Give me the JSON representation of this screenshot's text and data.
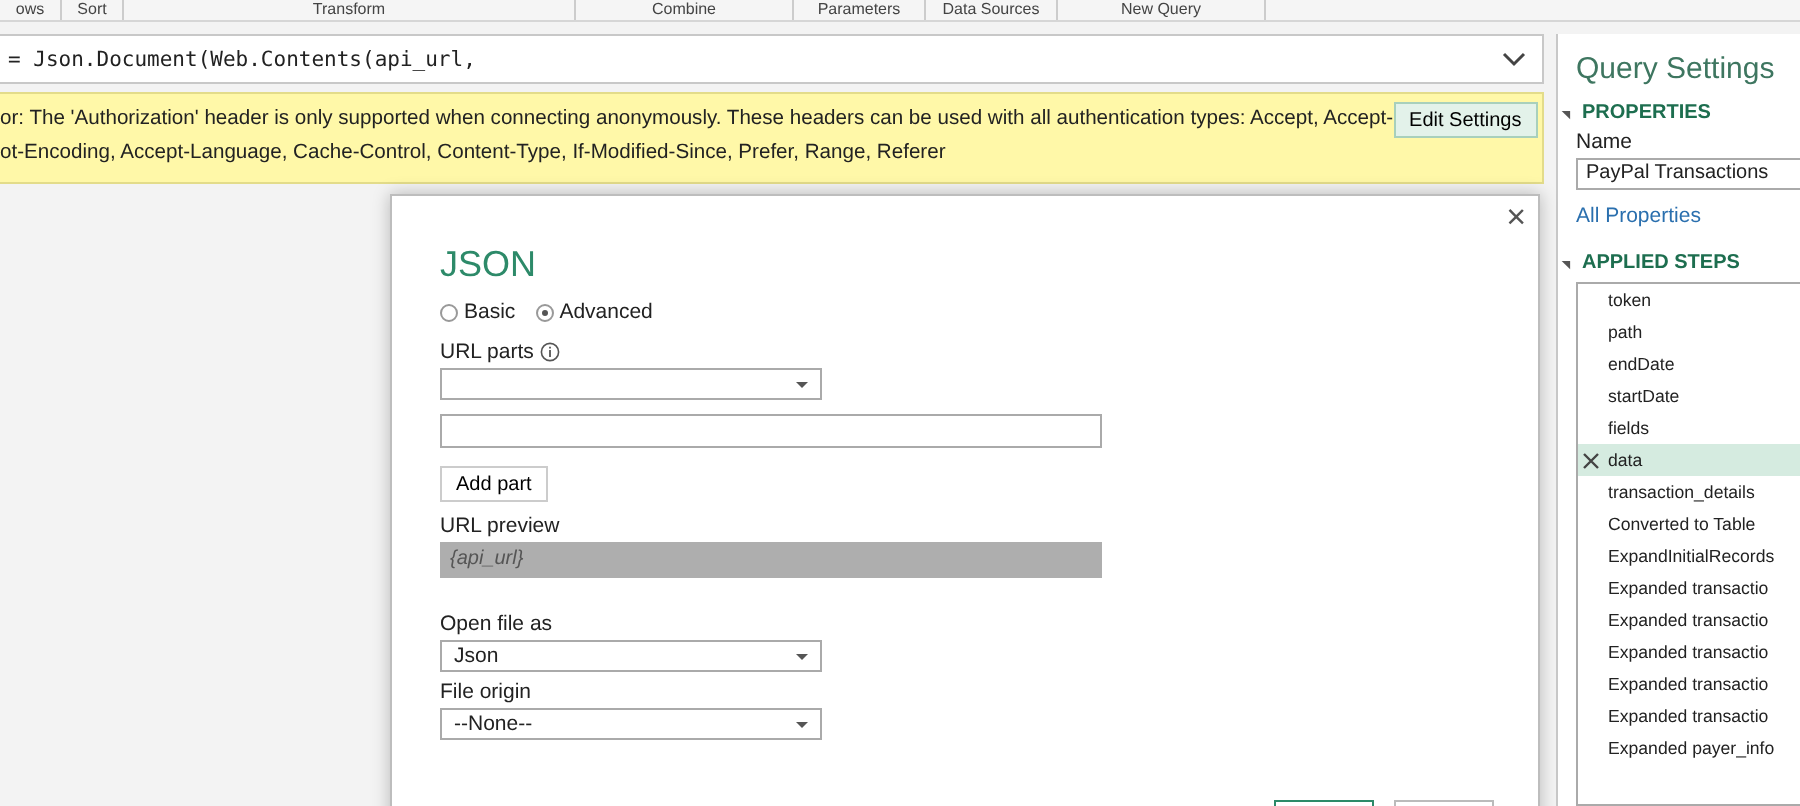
{
  "ribbon_groups": [
    "ows",
    "Sort",
    "Transform",
    "Combine",
    "Parameters",
    "Data Sources",
    "New Query"
  ],
  "formula_bar": {
    "value": "= Json.Document(Web.Contents(api_url,"
  },
  "warning": {
    "lines": [
      "or: The 'Authorization' header is only supported when connecting anonymously. These headers can be used with all authentication types: Accept, Accept-",
      "ot-Encoding, Accept-Language, Cache-Control, Content-Type, If-Modified-Since, Prefer, Range, Referer"
    ],
    "button": "Edit Settings"
  },
  "dialog": {
    "close": "×",
    "title": "JSON",
    "modes": [
      {
        "label": "Basic",
        "selected": false
      },
      {
        "label": "Advanced",
        "selected": true
      }
    ],
    "url_parts_label": "URL parts",
    "add_part": "Add part",
    "url_preview_label": "URL preview",
    "url_preview": "{api_url}",
    "open_file_as_label": "Open file as",
    "open_file_as": "Json",
    "file_origin_label": "File origin",
    "file_origin": "--None--"
  },
  "query_settings": {
    "title": "Query Settings",
    "properties_heading": "PROPERTIES",
    "name_label": "Name",
    "name_value": "PayPal Transactions",
    "all_properties": "All Properties",
    "applied_steps_heading": "APPLIED STEPS",
    "steps": [
      {
        "label": "token",
        "selected": false
      },
      {
        "label": "path",
        "selected": false
      },
      {
        "label": "endDate",
        "selected": false
      },
      {
        "label": "startDate",
        "selected": false
      },
      {
        "label": "fields",
        "selected": false
      },
      {
        "label": "data",
        "selected": true
      },
      {
        "label": "transaction_details",
        "selected": false
      },
      {
        "label": "Converted to Table",
        "selected": false
      },
      {
        "label": "ExpandInitialRecords",
        "selected": false
      },
      {
        "label": "Expanded transactio",
        "selected": false
      },
      {
        "label": "Expanded transactio",
        "selected": false
      },
      {
        "label": "Expanded transactio",
        "selected": false
      },
      {
        "label": "Expanded transactio",
        "selected": false
      },
      {
        "label": "Expanded transactio",
        "selected": false
      },
      {
        "label": "Expanded payer_info",
        "selected": false
      }
    ]
  }
}
